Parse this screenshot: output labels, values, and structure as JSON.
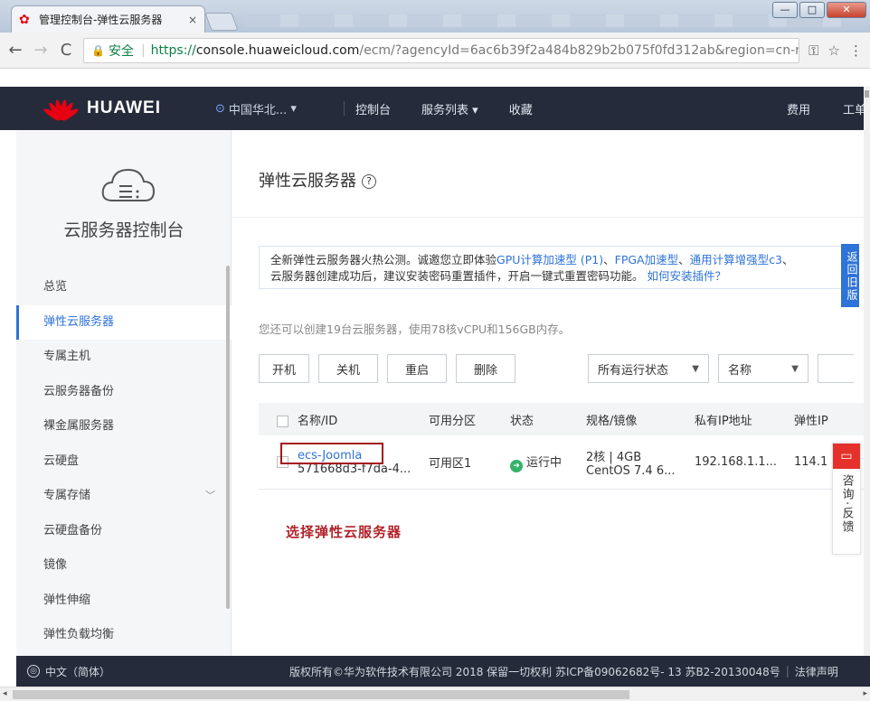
{
  "browser": {
    "tab_title": "管理控制台-弹性云服务器",
    "tab_close": "×",
    "url_secure_label": "安全",
    "url_scheme": "https://",
    "url_host": "console.huaweicloud.com",
    "url_path": "/ecm/?agencyId=6ac6b39f2a484b829b2b075f0fd312ab&region=cn-n...",
    "win_minimize": "—",
    "win_maximize": "□",
    "win_close": "✕"
  },
  "topnav": {
    "brand": "HUAWEI",
    "region": "中国华北...",
    "console": "控制台",
    "services": "服务列表",
    "favorites": "收藏",
    "billing": "费用",
    "tickets": "工单"
  },
  "sidebar": {
    "title": "云服务器控制台",
    "items": [
      {
        "label": "总览"
      },
      {
        "label": "弹性云服务器"
      },
      {
        "label": "专属主机"
      },
      {
        "label": "云服务器备份"
      },
      {
        "label": "裸金属服务器"
      },
      {
        "label": "云硬盘"
      },
      {
        "label": "专属存储"
      },
      {
        "label": "云硬盘备份"
      },
      {
        "label": "镜像"
      },
      {
        "label": "弹性伸缩"
      },
      {
        "label": "弹性负载均衡"
      }
    ]
  },
  "main": {
    "title": "弹性云服务器",
    "notice_line1_prefix": "全新弹性云服务器火热公测。诚邀您立即体验",
    "notice_link1": "GPU计算加速型 (P1)",
    "notice_mid1": "、",
    "notice_link2": "FPGA加速型",
    "notice_mid2": "、",
    "notice_link3": "通用计算增强型c3",
    "notice_mid3": "、",
    "notice_line2": "云服务器创建成功后，建议安装密码重置插件，开启一键式重置密码功能。",
    "notice_link4": "如何安装插件？",
    "back_old": "返回旧版",
    "quota": "您还可以创建19台云服务器，使用78核vCPU和156GB内存。",
    "buttons": {
      "start": "开机",
      "stop": "关机",
      "restart": "重启",
      "delete": "删除"
    },
    "filter_status": "所有运行状态",
    "filter_field": "名称",
    "table": {
      "headers": [
        "名称/ID",
        "可用分区",
        "状态",
        "规格/镜像",
        "私有IP地址",
        "弹性IP"
      ],
      "rows": [
        {
          "name": "ecs-Joomla",
          "id": "571668d3-f7da-4...",
          "zone": "可用区1",
          "status": "运行中",
          "spec": "2核 | 4GB",
          "image": "CentOS 7.4 6...",
          "private_ip": "192.168.1.1...",
          "eip": "114.1"
        }
      ]
    },
    "annotation": "选择弹性云服务器",
    "feedback": "咨询·反馈"
  },
  "footer": {
    "language": "中文（简体）",
    "copyright": "版权所有©华为软件技术有限公司 2018 保留一切权利 苏ICP备09062682号- 13   苏B2-20130048号",
    "legal": "法律声明"
  }
}
